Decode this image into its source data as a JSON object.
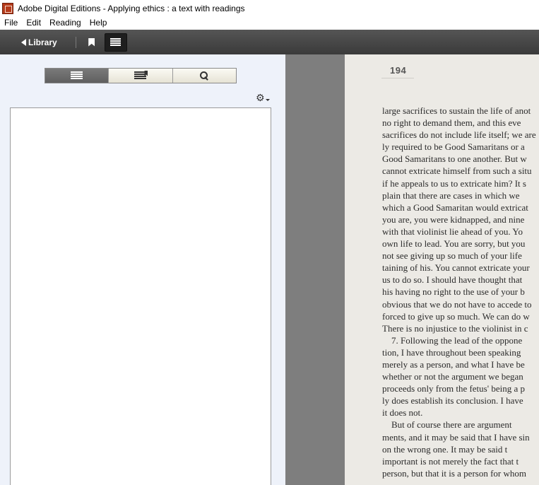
{
  "window": {
    "title": "Adobe Digital Editions - Applying ethics : a text with readings"
  },
  "menu": [
    "File",
    "Edit",
    "Reading",
    "Help"
  ],
  "toolbar": {
    "library_label": "Library"
  },
  "sidebar": {
    "tabs": [
      "toc-list-icon",
      "bookmark-list-icon",
      "search-icon"
    ],
    "active_tab": 0
  },
  "reader": {
    "page_number": "194",
    "lines": [
      "large sacrifices to sustain the life of anot",
      "no right to demand them, and this eve",
      "sacrifices do not include life itself; we are",
      "ly required to be Good Samaritans or a",
      "Good Samaritans to one another. But w",
      "cannot extricate himself from such a situ",
      "if he appeals to us to extricate him? It s",
      "plain that there are cases in which we",
      "which a Good Samaritan would extricat",
      "you are, you were kidnapped, and nine",
      "with that violinist lie ahead of you. Yo",
      "own life to lead. You are sorry, but you",
      "not see giving up so much of your life",
      "taining of his. You cannot extricate your",
      "us to do so. I should have thought that",
      "his having no right to the use of your b",
      "obvious that we do not have to accede to",
      "forced to give up so much. We can do w",
      "There is no injustice to the violinist in c",
      "    7. Following the lead of the oppone",
      "tion, I have throughout been speaking",
      "merely as a person, and what I have be",
      "whether or not the argument we began",
      "proceeds only from the fetus' being a p",
      "ly does establish its conclusion. I have",
      "it does not.",
      "    But of course there are argument",
      "ments, and it may be said that I have sin",
      "on the wrong one. It may be said t",
      "important is not merely the fact that t",
      "person, but that it is a person for whom"
    ]
  }
}
